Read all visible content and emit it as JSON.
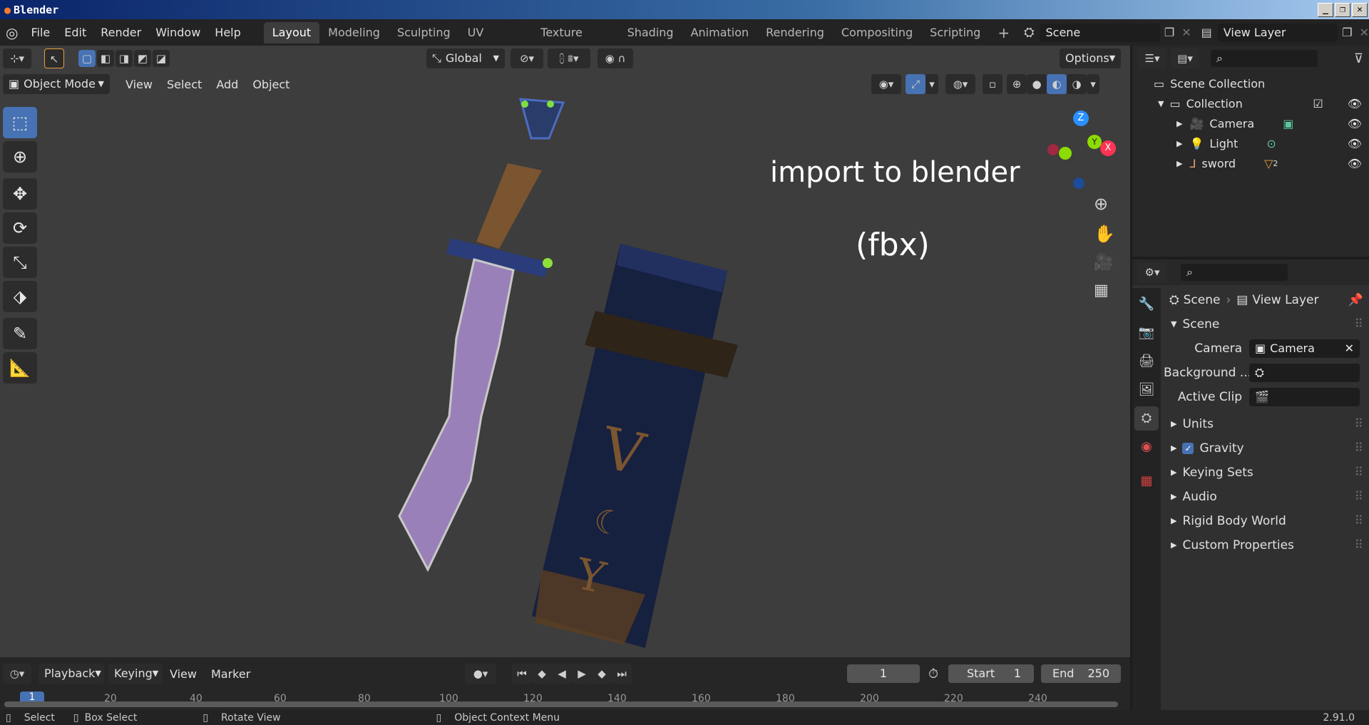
{
  "window": {
    "title": "Blender",
    "buttons": [
      "_",
      "❐",
      "✕"
    ]
  },
  "menu": [
    "File",
    "Edit",
    "Render",
    "Window",
    "Help"
  ],
  "workspaces": [
    "Layout",
    "Modeling",
    "Sculpting",
    "UV Editing",
    "Texture Paint",
    "Shading",
    "Animation",
    "Rendering",
    "Compositing",
    "Scripting"
  ],
  "workspace_add": "+",
  "scene_field": "Scene",
  "view_layer_field": "View Layer",
  "viewport_header": {
    "transform_orientation": "Global",
    "options_label": "Options",
    "mode": "Object Mode",
    "menus": [
      "View",
      "Select",
      "Add",
      "Object"
    ]
  },
  "overlay_text": {
    "line1": "import to blender",
    "line2": "(fbx)"
  },
  "gizmo": {
    "z": "Z",
    "y": "Y",
    "x": "X"
  },
  "outliner": {
    "root": "Scene Collection",
    "collection": "Collection",
    "items": [
      {
        "name": "Camera",
        "icon": "camera-icon",
        "color": "#e8a070"
      },
      {
        "name": "Light",
        "icon": "light-icon",
        "color": "#e8a070"
      },
      {
        "name": "sword",
        "icon": "mesh-icon",
        "color": "#e8a070",
        "badge": "2"
      }
    ]
  },
  "properties": {
    "breadcrumb_scene": "Scene",
    "breadcrumb_view_layer": "View Layer",
    "panel_title": "Scene",
    "camera_label": "Camera",
    "camera_value": "Camera",
    "background_label": "Background ...",
    "active_clip_label": "Active Clip",
    "sections": [
      "Units",
      "Gravity",
      "Keying Sets",
      "Audio",
      "Rigid Body World",
      "Custom Properties"
    ],
    "gravity_checked": true
  },
  "timeline": {
    "menus": [
      "Playback",
      "Keying",
      "View",
      "Marker"
    ],
    "current_frame": "1",
    "start_label": "Start",
    "start_value": "1",
    "end_label": "End",
    "end_value": "250",
    "ticks": [
      "20",
      "40",
      "60",
      "80",
      "100",
      "120",
      "140",
      "160",
      "180",
      "200",
      "220",
      "240"
    ],
    "playhead": "1"
  },
  "statusbar": {
    "select": "Select",
    "box_select": "Box Select",
    "rotate_view": "Rotate View",
    "context_menu": "Object Context Menu",
    "version": "2.91.0"
  },
  "colors": {
    "accent": "#4772b3",
    "viewport_bg": "#3d3d3d",
    "x_axis": "#ff3352",
    "y_axis": "#8bdc00",
    "z_axis": "#2890ff"
  }
}
